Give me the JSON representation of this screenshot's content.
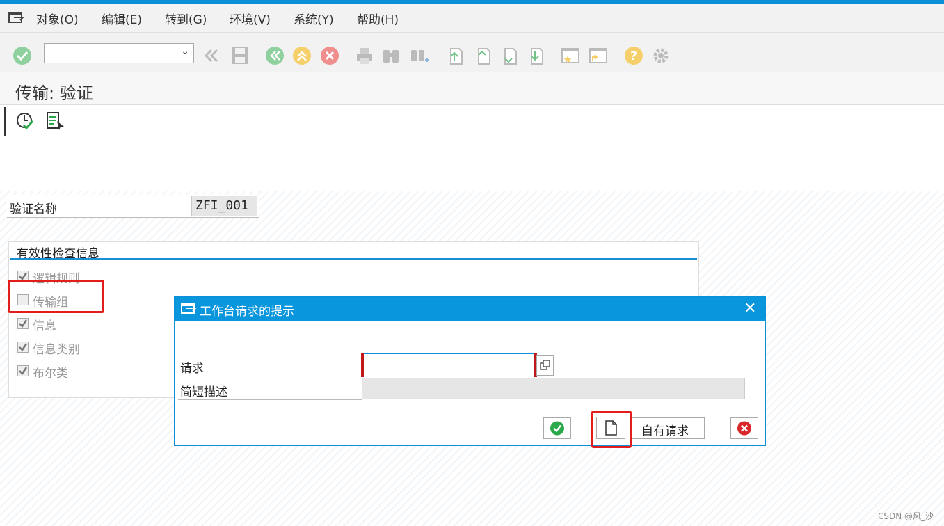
{
  "menubar": {
    "items": [
      "对象(O)",
      "编辑(E)",
      "转到(G)",
      "环境(V)",
      "系统(Y)",
      "帮助(H)"
    ]
  },
  "toolbar": {
    "command_field_value": "",
    "icons": [
      "enter-icon",
      "back-icon",
      "save-icon",
      "back-icon",
      "exit-icon",
      "cancel-icon",
      "print-icon",
      "find-icon",
      "find-next-icon",
      "first-page-icon",
      "previous-page-icon",
      "next-page-icon",
      "last-page-icon",
      "create-session-icon",
      "shortcut-icon",
      "help-icon",
      "settings-icon"
    ]
  },
  "page": {
    "title": "传输: 验证"
  },
  "form": {
    "validation_name_label": "验证名称",
    "validation_name_value": "ZFI_001"
  },
  "group": {
    "title": "有效性检查信息",
    "items": [
      {
        "label": "逻辑规则",
        "checked": true
      },
      {
        "label": "传输组",
        "checked": false
      },
      {
        "label": "信息",
        "checked": true
      },
      {
        "label": "信息类别",
        "checked": true
      },
      {
        "label": "布尔类",
        "checked": true
      }
    ]
  },
  "dialog": {
    "title": "工作台请求的提示",
    "request_label": "请求",
    "request_value": "",
    "short_desc_label": "简短描述",
    "short_desc_value": "",
    "own_requests_label": "自有请求"
  },
  "colors": {
    "accent": "#0a96dc",
    "highlight": "#e31c1c",
    "ok_green": "#2aa84a",
    "cancel_red": "#d9262b"
  },
  "watermark": "CSDN @风_沙"
}
